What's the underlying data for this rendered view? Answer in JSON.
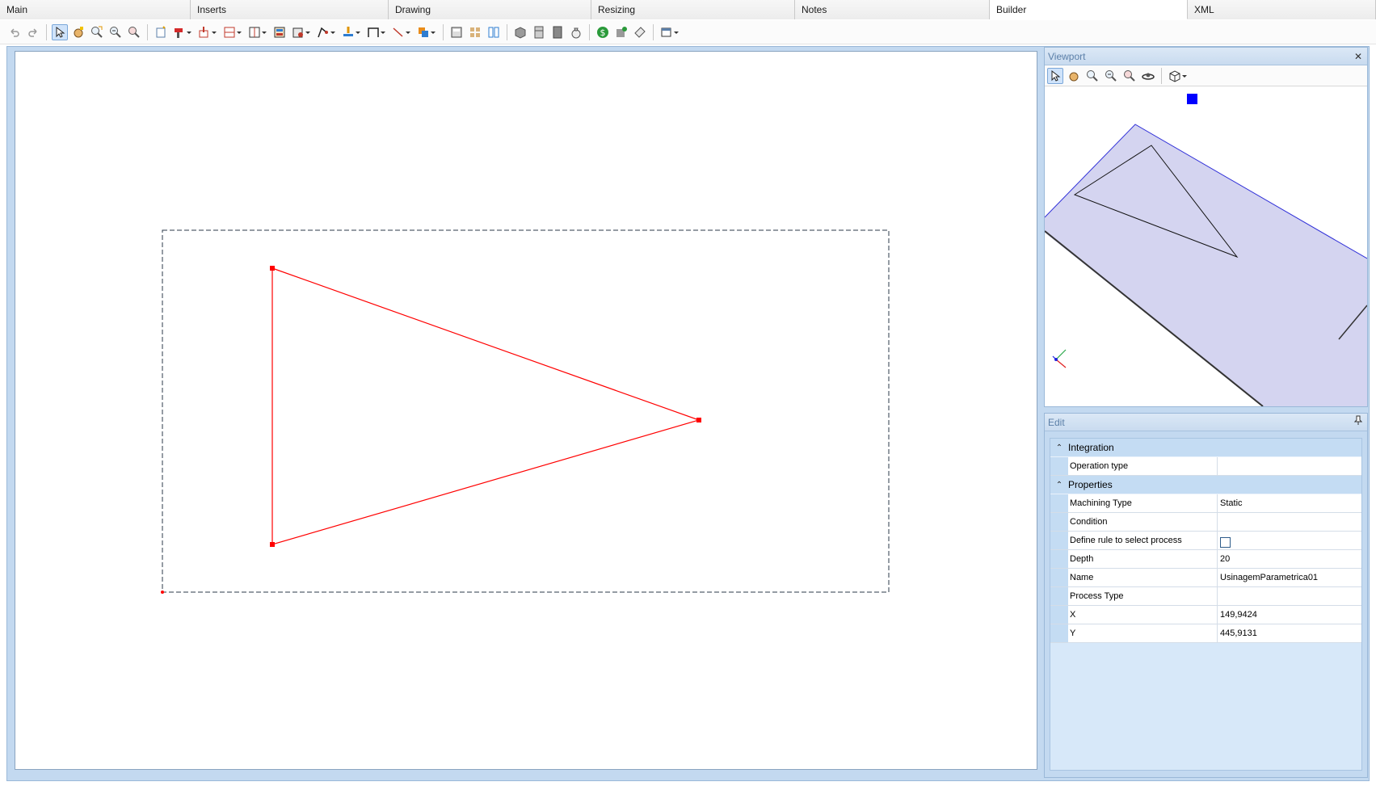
{
  "tabs": [
    "Main",
    "Inserts",
    "Drawing",
    "Resizing",
    "Notes",
    "Builder",
    "XML"
  ],
  "active_tab": "Builder",
  "toolbar": {
    "groups": [
      [
        "undo-icon",
        "redo-icon"
      ],
      [
        "select-icon",
        "pan-icon",
        "zoom-window-icon",
        "zoom-out-icon",
        "zoom-extents-icon"
      ],
      [
        "new-part-icon",
        "drill-icon",
        "insert-part-icon",
        "panel-icon",
        "frame-icon",
        "hardware-icon",
        "edge-icon",
        "line-tool-icon",
        "pin-icon",
        "dimension-icon",
        "segment-icon",
        "copy-icon"
      ],
      [
        "calculator-icon",
        "grid-icon",
        "split-icon"
      ],
      [
        "box-icon",
        "cabinet-icon",
        "door-icon",
        "money-bag-icon"
      ],
      [
        "dollar-icon",
        "material-icon",
        "label-icon"
      ],
      [
        "window-layout-icon"
      ]
    ]
  },
  "viewport": {
    "title": "Viewport",
    "close_glyph": "✕",
    "tools": [
      "select-icon",
      "pan-icon",
      "zoom-in-icon",
      "zoom-out-icon",
      "zoom-extents-icon",
      "orbit-icon",
      "view-cube-icon"
    ],
    "colors": {
      "board": "#d4d4f0",
      "board_edge": "#2f2fd8",
      "cube": "#0000ff"
    }
  },
  "edit": {
    "title": "Edit",
    "categories": [
      {
        "name": "Integration",
        "toggle": "⌃",
        "rows": [
          {
            "name": "Operation type",
            "value": ""
          }
        ]
      },
      {
        "name": "Properties",
        "toggle": "⌃",
        "rows": [
          {
            "name": "Machining Type",
            "value": "Static"
          },
          {
            "name": "Condition",
            "value": ""
          },
          {
            "name": "Define rule to select process",
            "value": "",
            "checkbox": true,
            "checked": false
          },
          {
            "name": "Depth",
            "value": "20"
          },
          {
            "name": "Name",
            "value": "UsinagemParametrica01"
          },
          {
            "name": "Process Type",
            "value": ""
          },
          {
            "name": "X",
            "value": "149,9424"
          },
          {
            "name": "Y",
            "value": "445,9131"
          }
        ]
      }
    ]
  },
  "canvas": {
    "colors": {
      "shape": "#ff0000",
      "boundary": "#2b3a4a"
    }
  }
}
